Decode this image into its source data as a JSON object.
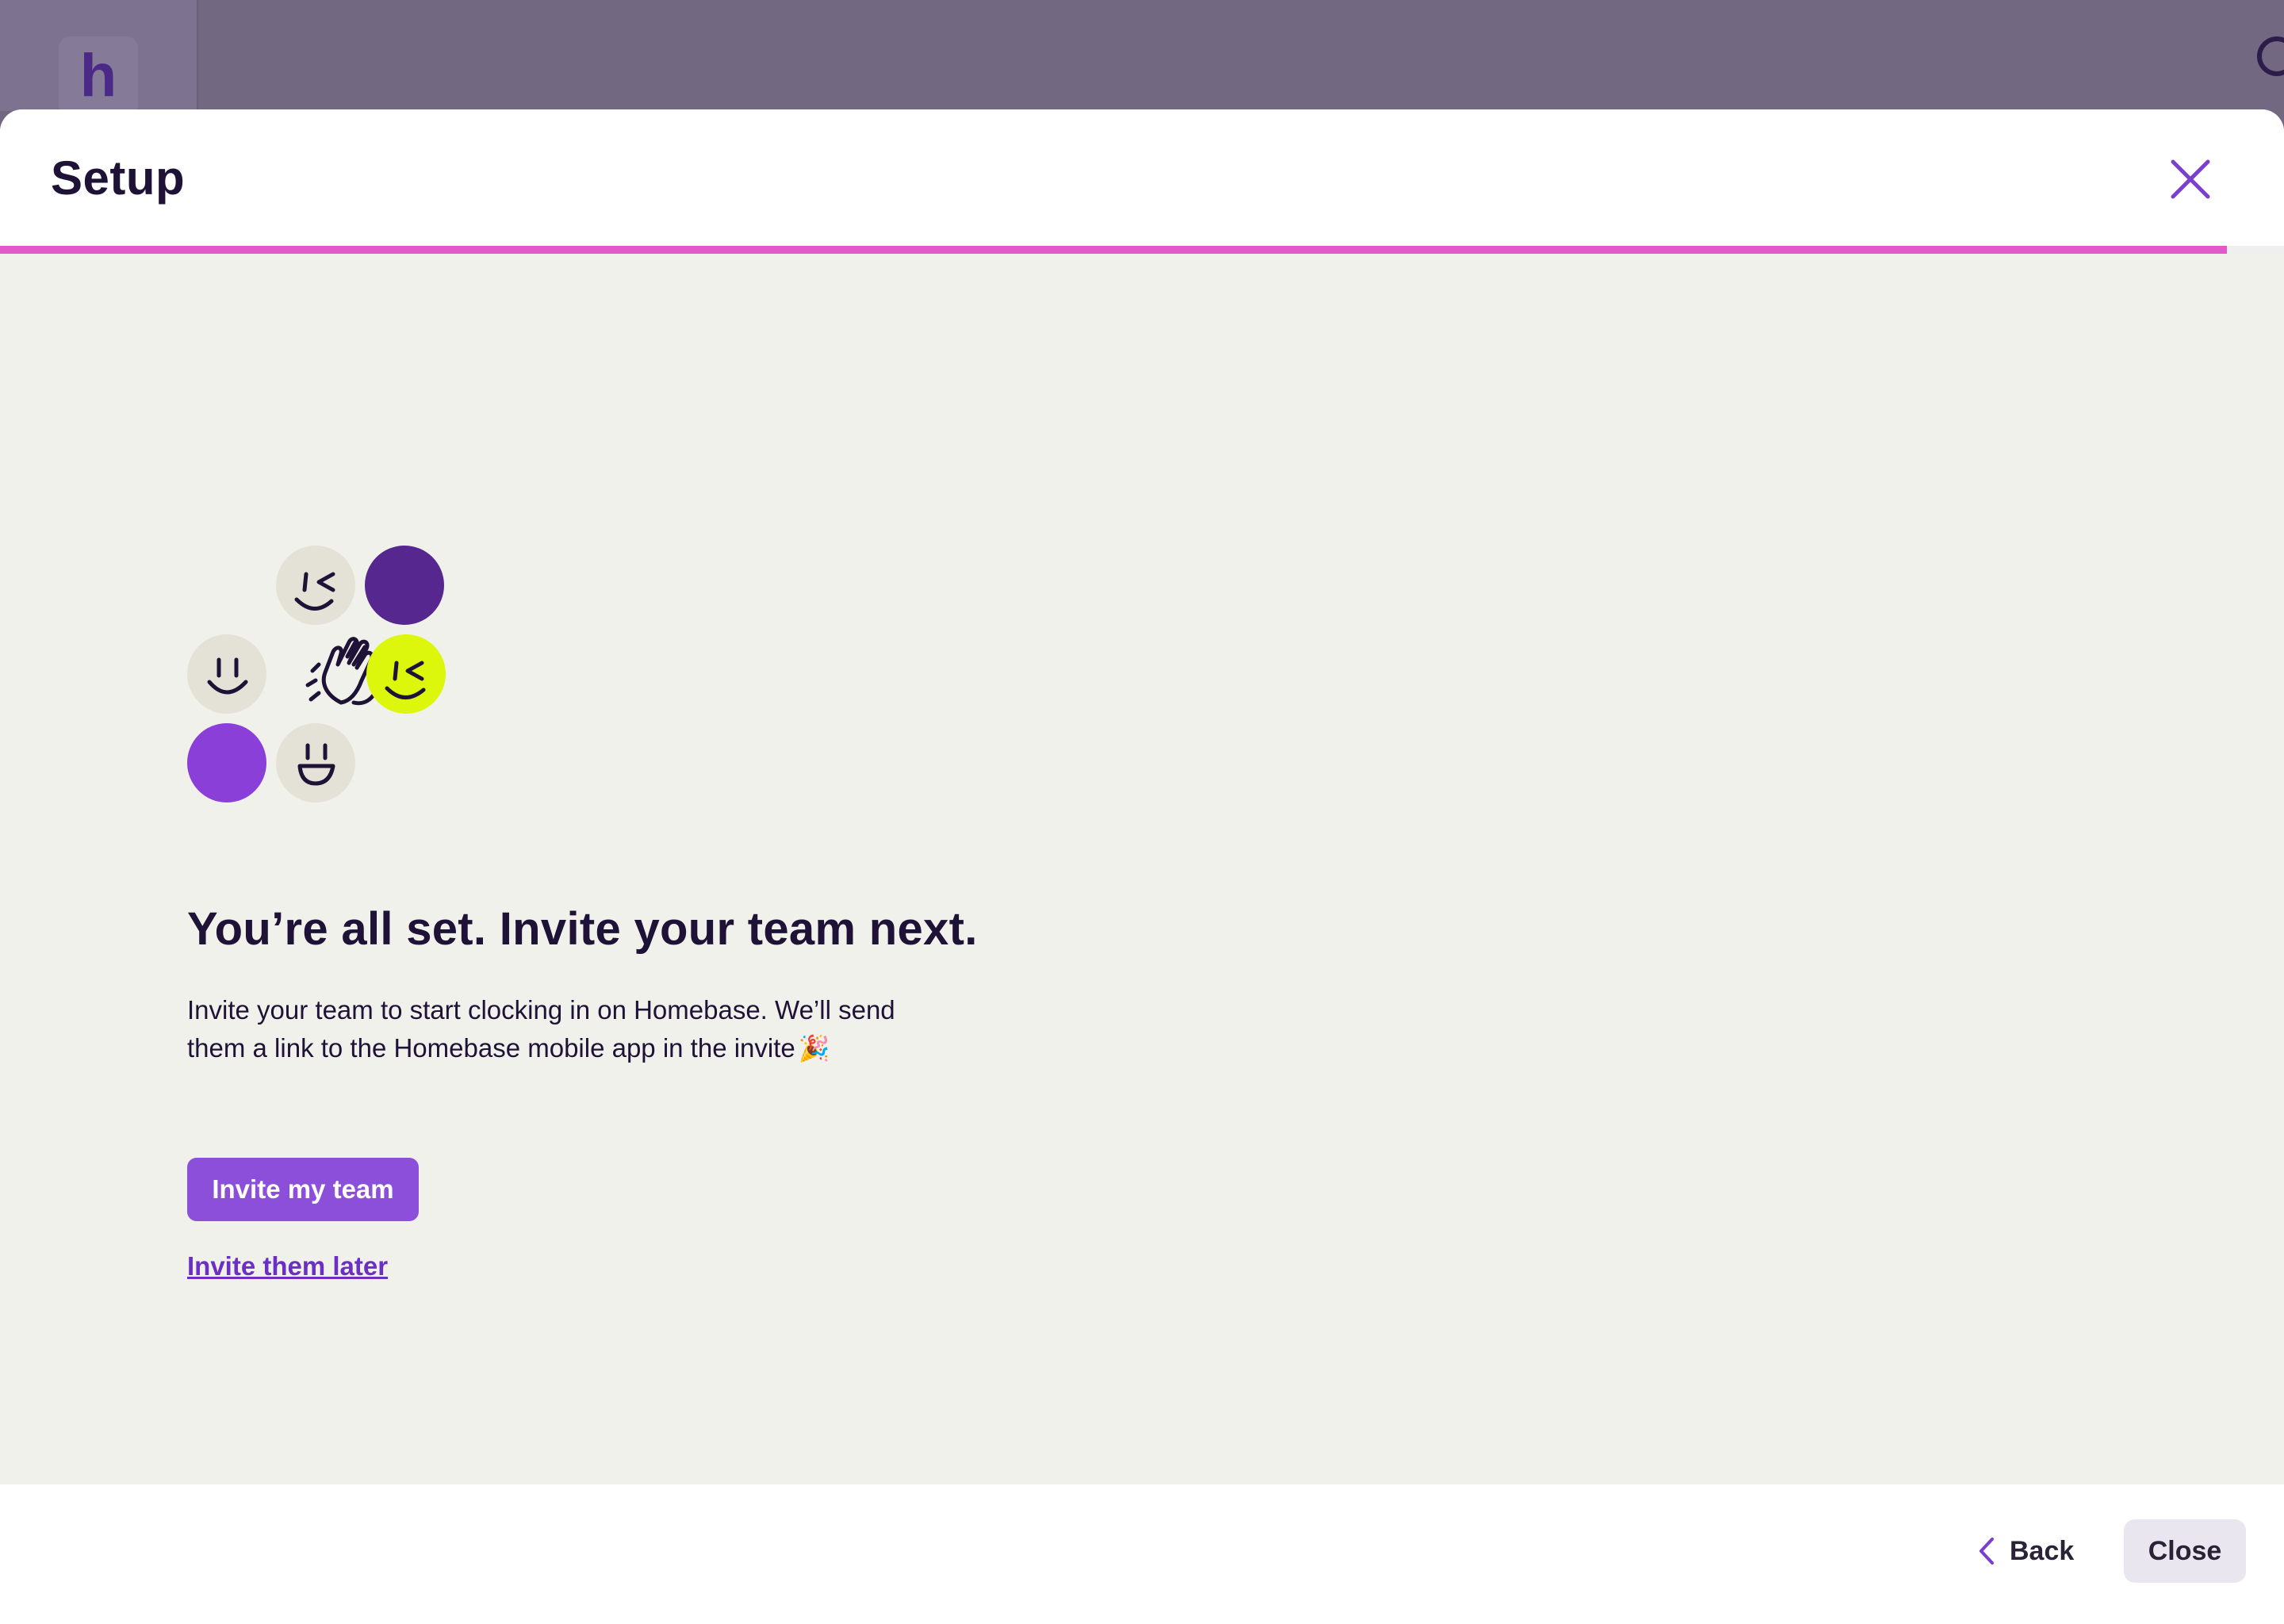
{
  "app": {
    "logo_letter": "h"
  },
  "modal": {
    "title": "Setup",
    "progress_percent": 97.5
  },
  "content": {
    "headline": "You’re all set. Invite your team next.",
    "body_line1": "Invite your team to start clocking in on Homebase. We’ll send",
    "body_line2": "them a link to the Homebase mobile app in the invite",
    "body_emoji": "🎉",
    "primary_button": "Invite my team",
    "secondary_link": "Invite them later"
  },
  "footer": {
    "back_label": "Back",
    "close_label": "Close"
  },
  "colors": {
    "accent_purple": "#8b4fd9",
    "dark_purple": "#56278f",
    "lime": "#dcf60c",
    "progress_pink": "#e25ac8",
    "content_bg": "#f1f1ec",
    "text_dark": "#1f1237"
  }
}
